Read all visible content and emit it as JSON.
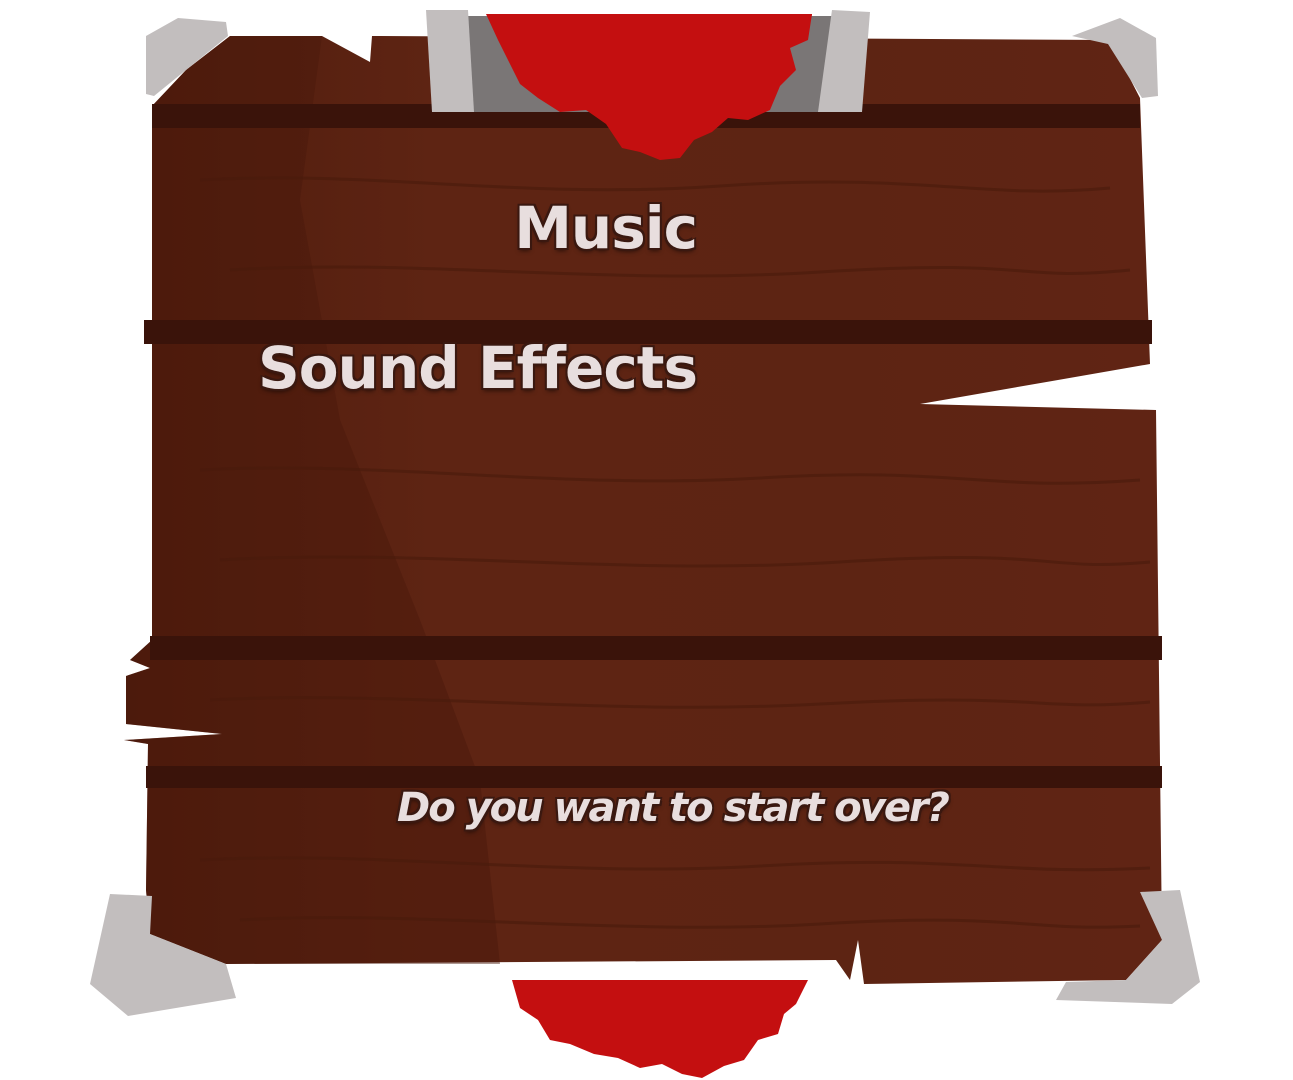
{
  "settings_board": {
    "music_label": "Music",
    "sound_effects_label": "Sound Effects",
    "restart_prompt": "Do you want to start over?"
  },
  "colors": {
    "wood": "#5c2312",
    "wood_dark_groove": "#3a130a",
    "banner_red": "#c40f10",
    "corner_metal": "#c2bebe",
    "clip_metal": "#7a7676",
    "text": "#e8dede",
    "text_outline": "#3a1810"
  }
}
